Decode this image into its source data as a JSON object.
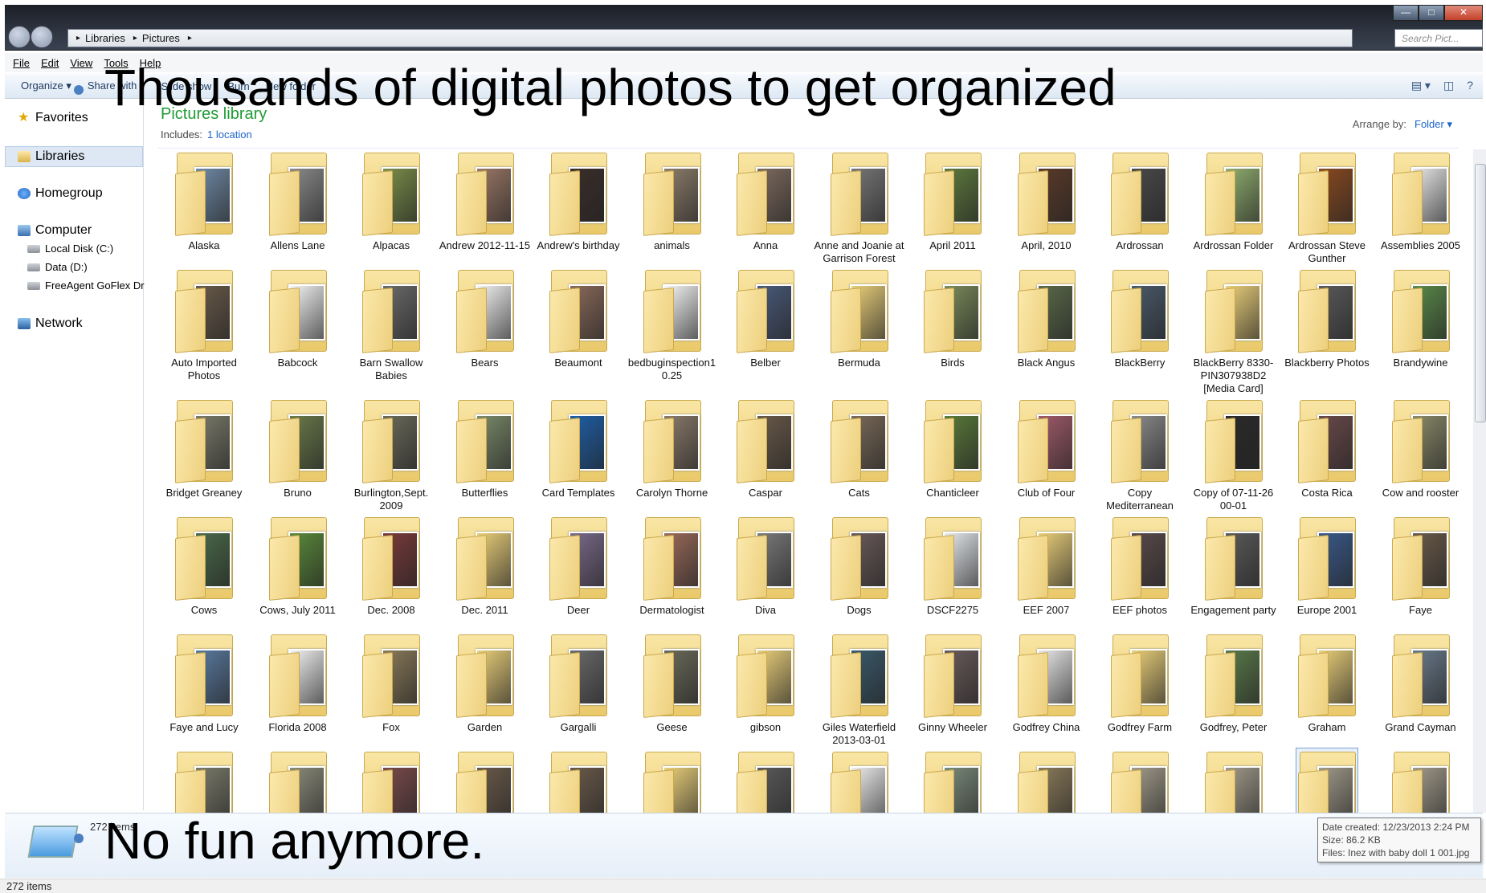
{
  "window": {
    "breadcrumb": [
      "Libraries",
      "Pictures"
    ],
    "search_placeholder": "Search Pict...",
    "controls": [
      "—",
      "□",
      "✕"
    ]
  },
  "menu": [
    "File",
    "Edit",
    "View",
    "Tools",
    "Help"
  ],
  "toolbar": [
    "Organize ▾",
    "Share with ▾",
    "Slide show",
    "Burn",
    "New folder"
  ],
  "overlay": {
    "title": "Thousands of digital photos to get organized",
    "bottom": "No fun anymore."
  },
  "nav": {
    "favorites": "Favorites",
    "libraries": "Libraries",
    "homegroup": "Homegroup",
    "computer": "Computer",
    "drives": [
      "Local Disk (C:)",
      "Data (D:)",
      "FreeAgent GoFlex Dr"
    ],
    "network": "Network"
  },
  "library": {
    "title": "Pictures library",
    "includes_label": "Includes:",
    "includes_link": "1 location",
    "arrange_label": "Arrange by:",
    "arrange_value": "Folder ▾"
  },
  "folders": [
    {
      "name": "Alaska",
      "c": "#6f8aa6"
    },
    {
      "name": "Allens Lane",
      "c": "#8a8a8a"
    },
    {
      "name": "Alpacas",
      "c": "#7a8f4a"
    },
    {
      "name": "Andrew 2012-11-15",
      "c": "#9a7766"
    },
    {
      "name": "Andrew's birthday",
      "c": "#3a2e2a"
    },
    {
      "name": "animals",
      "c": "#8c7d6a"
    },
    {
      "name": "Anna",
      "c": "#7d6a5e"
    },
    {
      "name": "Anne and Joanie at Garrison Forest",
      "c": "#777"
    },
    {
      "name": "April 2011",
      "c": "#5e7a3e"
    },
    {
      "name": "April, 2010",
      "c": "#5a3a2a"
    },
    {
      "name": "Ardrossan",
      "c": "#4a4a4a"
    },
    {
      "name": "Ardrossan Folder",
      "c": "#8fae6e"
    },
    {
      "name": "Ardrossan Steve Gunther",
      "c": "#8a4a20"
    },
    {
      "name": "Assemblies 2005",
      "c": "#e8e8e8"
    },
    {
      "name": "Auto Imported Photos",
      "c": "#6a5a4a"
    },
    {
      "name": "Babcock",
      "c": "#f4f4f4"
    },
    {
      "name": "Barn Swallow Babies",
      "c": "#6a6a6a"
    },
    {
      "name": "Bears",
      "c": "#f2f2f2"
    },
    {
      "name": "Beaumont",
      "c": "#8a6a5a"
    },
    {
      "name": "bedbuginspection10.25",
      "c": "#f6f6f6"
    },
    {
      "name": "Belber",
      "c": "#4a5a7a"
    },
    {
      "name": "Bermuda",
      "c": "#e9cf7a"
    },
    {
      "name": "Birds",
      "c": "#7a8a5a"
    },
    {
      "name": "Black Angus",
      "c": "#5a6a4a"
    },
    {
      "name": "BlackBerry",
      "c": "#4a5a6a"
    },
    {
      "name": "BlackBerry 8330-PIN307938D2 [Media Card]",
      "c": "#e9cf7a"
    },
    {
      "name": "Blackberry Photos",
      "c": "#5a5a5a"
    },
    {
      "name": "Brandywine",
      "c": "#5a8a4a"
    },
    {
      "name": "Bridget Greaney",
      "c": "#7a7a6a"
    },
    {
      "name": "Bruno",
      "c": "#6a7a4a"
    },
    {
      "name": "Burlington,Sept. 2009",
      "c": "#6a6a5a"
    },
    {
      "name": "Butterflies",
      "c": "#7a8a6a"
    },
    {
      "name": "Card Templates",
      "c": "#1e5fa8"
    },
    {
      "name": "Carolyn Thorne",
      "c": "#8a7a6a"
    },
    {
      "name": "Caspar",
      "c": "#6a5a4a"
    },
    {
      "name": "Cats",
      "c": "#7a6a5a"
    },
    {
      "name": "Chanticleer",
      "c": "#5a7a3a"
    },
    {
      "name": "Club of Four",
      "c": "#a05a6a"
    },
    {
      "name": "Copy Mediterranean",
      "c": "#8a8a8a"
    },
    {
      "name": "Copy of 07-11-26 00-01",
      "c": "#2a2a2a"
    },
    {
      "name": "Costa Rica",
      "c": "#6a4a4a"
    },
    {
      "name": "Cow and rooster",
      "c": "#8a8a6a"
    },
    {
      "name": "Cows",
      "c": "#4a6a4a"
    },
    {
      "name": "Cows, July 2011",
      "c": "#5a8a3a"
    },
    {
      "name": "Dec. 2008",
      "c": "#7a3a3a"
    },
    {
      "name": "Dec. 2011",
      "c": "#e9cf7a"
    },
    {
      "name": "Deer",
      "c": "#7a6a8a"
    },
    {
      "name": "Dermatologist",
      "c": "#9a6a5a"
    },
    {
      "name": "Diva",
      "c": "#7a7a7a"
    },
    {
      "name": "Dogs",
      "c": "#6a5a5a"
    },
    {
      "name": "DSCF2275",
      "c": "#e6eaee"
    },
    {
      "name": "EEF 2007",
      "c": "#e9cf7a"
    },
    {
      "name": "EEF photos",
      "c": "#5a4a4a"
    },
    {
      "name": "Engagement party",
      "c": "#5a5a5a"
    },
    {
      "name": "Europe 2001",
      "c": "#3a5a8a"
    },
    {
      "name": "Faye",
      "c": "#6a5a4a"
    },
    {
      "name": "Faye and Lucy",
      "c": "#5a7aa0"
    },
    {
      "name": "Florida 2008",
      "c": "#f2f2f2"
    },
    {
      "name": "Fox",
      "c": "#8a7a5a"
    },
    {
      "name": "Garden",
      "c": "#e9cf7a"
    },
    {
      "name": "Gargalli",
      "c": "#6a6a6a"
    },
    {
      "name": "Geese",
      "c": "#6a6a5a"
    },
    {
      "name": "gibson",
      "c": "#e9cf7a"
    },
    {
      "name": "Giles Waterfield 2013-03-01",
      "c": "#3a5a6a"
    },
    {
      "name": "Ginny Wheeler",
      "c": "#6a5a5a"
    },
    {
      "name": "Godfrey China",
      "c": "#e8e8e8"
    },
    {
      "name": "Godfrey Farm",
      "c": "#e9cf7a"
    },
    {
      "name": "Godfrey, Peter",
      "c": "#5a7a4a"
    },
    {
      "name": "Graham",
      "c": "#e9cf7a"
    },
    {
      "name": "Grand Cayman",
      "c": "#6a7a8a"
    },
    {
      "name": "",
      "c": "#7a7a6a"
    },
    {
      "name": "",
      "c": "#8a8a7a"
    },
    {
      "name": "",
      "c": "#7a4a4a"
    },
    {
      "name": "",
      "c": "#6a5a4a"
    },
    {
      "name": "",
      "c": "#6a5a4a"
    },
    {
      "name": "",
      "c": "#e9cf7a"
    },
    {
      "name": "",
      "c": "#5a5a5a"
    },
    {
      "name": "",
      "c": "#eeeeee"
    },
    {
      "name": "",
      "c": "#7a8a7a"
    },
    {
      "name": "",
      "c": "#8a7a5a"
    },
    {
      "name": "",
      "c": "#a09a8a"
    },
    {
      "name": "",
      "c": "#a09a8a"
    },
    {
      "name": "",
      "c": "#a09a8a"
    },
    {
      "name": "",
      "c": "#a09a8a"
    }
  ],
  "details": {
    "items_count": "272 items",
    "tooltip": [
      "Date created: 12/23/2013 2:24 PM",
      "Size: 86.2 KB",
      "Files: Inez with baby doll 1 001.jpg"
    ]
  },
  "status_bar": "272 items"
}
